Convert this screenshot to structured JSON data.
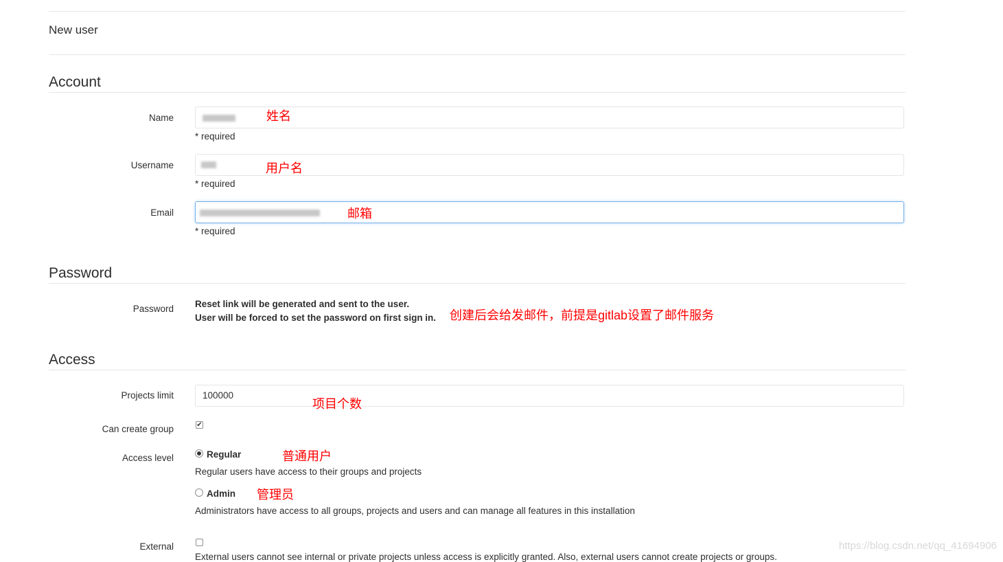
{
  "header": {
    "title": "New user"
  },
  "account": {
    "title": "Account",
    "name": {
      "label": "Name",
      "help": "* required",
      "annotation": "姓名"
    },
    "username": {
      "label": "Username",
      "help": "* required",
      "annotation": "用户名"
    },
    "email": {
      "label": "Email",
      "help": "* required",
      "annotation": "邮箱"
    }
  },
  "password": {
    "title": "Password",
    "label": "Password",
    "line1": "Reset link will be generated and sent to the user.",
    "line2": "User will be forced to set the password on first sign in.",
    "annotation": "创建后会给发邮件，前提是gitlab设置了邮件服务"
  },
  "access": {
    "title": "Access",
    "projects_limit": {
      "label": "Projects limit",
      "value": "100000",
      "annotation": "项目个数"
    },
    "can_create_group": {
      "label": "Can create group",
      "checked": true
    },
    "access_level": {
      "label": "Access level",
      "regular": {
        "label": "Regular",
        "desc": "Regular users have access to their groups and projects",
        "annotation": "普通用户",
        "selected": true
      },
      "admin": {
        "label": "Admin",
        "desc": "Administrators have access to all groups, projects and users and can manage all features in this installation",
        "annotation": "管理员",
        "selected": false
      }
    },
    "external": {
      "label": "External",
      "checked": false,
      "desc": "External users cannot see internal or private projects unless access is explicitly granted. Also, external users cannot create projects or groups."
    }
  },
  "watermark": "https://blog.csdn.net/qq_41694906",
  "colors": {
    "annotation": "#ff0000",
    "focus_border": "#73afea",
    "divider": "#e5e5e5"
  }
}
